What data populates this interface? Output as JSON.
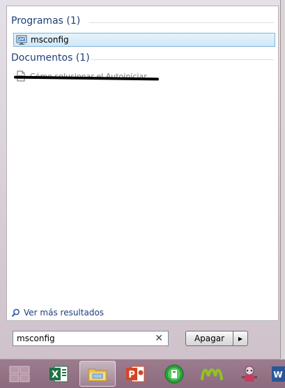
{
  "results": {
    "groups": [
      {
        "header": "Programas (1)",
        "items": [
          {
            "label": "msconfig",
            "icon": "msconfig-app-icon",
            "selected": true
          }
        ]
      },
      {
        "header": "Documentos (1)",
        "items": [
          {
            "label": "Cómo solucionar el Autoiniciar",
            "icon": "document-icon",
            "redacted": true
          }
        ]
      }
    ],
    "see_more": "Ver más resultados"
  },
  "search": {
    "value": "msconfig",
    "clear_icon": "close-icon"
  },
  "shutdown": {
    "label": "Apagar",
    "arrow_icon": "triangle-right-icon"
  },
  "taskbar": {
    "items": [
      {
        "name": "start-button",
        "icon": "windows-logo-icon"
      },
      {
        "name": "taskbar-excel",
        "icon": "excel-icon",
        "color": "#1f7145"
      },
      {
        "name": "taskbar-explorer",
        "icon": "folder-icon",
        "active": true
      },
      {
        "name": "taskbar-powerpoint",
        "icon": "powerpoint-icon",
        "color": "#d24625"
      },
      {
        "name": "taskbar-green-app",
        "icon": "green-circle-app-icon",
        "color": "#2aa03a"
      },
      {
        "name": "taskbar-movistar",
        "icon": "movistar-icon",
        "color": "#8fc31f"
      },
      {
        "name": "taskbar-game",
        "icon": "character-app-icon"
      },
      {
        "name": "taskbar-word",
        "icon": "word-icon",
        "color": "#2b5797"
      }
    ]
  }
}
